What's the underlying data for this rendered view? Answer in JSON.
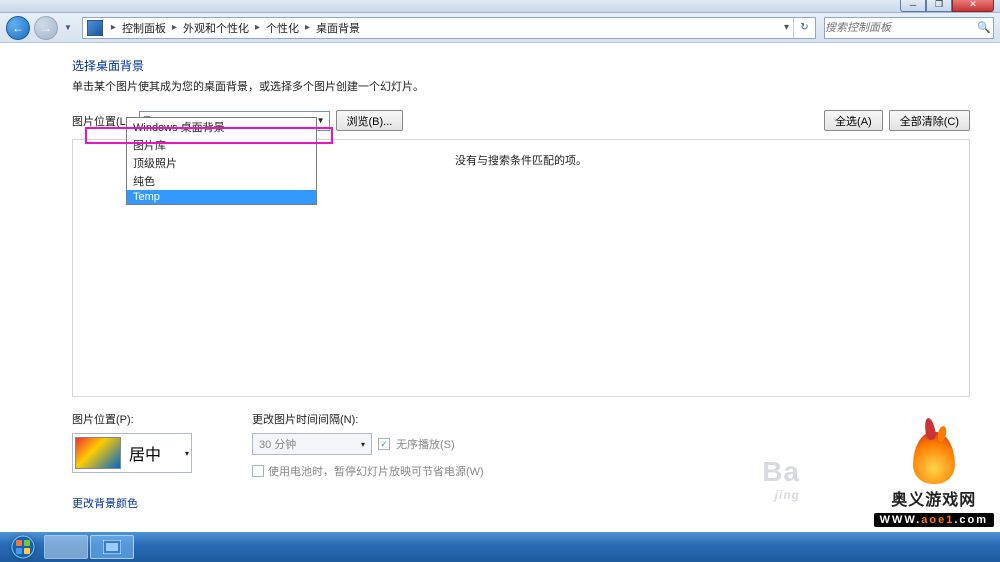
{
  "breadcrumb": {
    "seg1": "控制面板",
    "seg2": "外观和个性化",
    "seg3": "个性化",
    "seg4": "桌面背景"
  },
  "search": {
    "placeholder": "搜索控制面板"
  },
  "page": {
    "title": "选择桌面背景",
    "subtitle": "单击某个图片使其成为您的桌面背景，或选择多个图片创建一个幻灯片。"
  },
  "picloc": {
    "label": "图片位置(L):",
    "selected": "Temp",
    "browse": "浏览(B)...",
    "options": [
      "Windows 桌面背景",
      "图片库",
      "顶级照片",
      "纯色",
      "Temp"
    ]
  },
  "buttons": {
    "select_all": "全选(A)",
    "clear_all": "全部清除(C)"
  },
  "preview": {
    "empty": "没有与搜索条件匹配的项。"
  },
  "position": {
    "label": "图片位置(P):",
    "value": "居中"
  },
  "interval": {
    "label": "更改图片时间间隔(N):",
    "value": "30 分钟",
    "shuffle": "无序播放(S)",
    "battery": "使用电池时，暂停幻灯片放映可节省电源(W)"
  },
  "link": {
    "change_bg_color": "更改背景颜色"
  },
  "watermark": {
    "site_name": "奥义游戏网",
    "site_url_prefix": "WWW.",
    "site_url_mid": "aoe1",
    "site_url_suffix": ".com",
    "baidu": "Ba",
    "baidu_sub": "jing"
  }
}
